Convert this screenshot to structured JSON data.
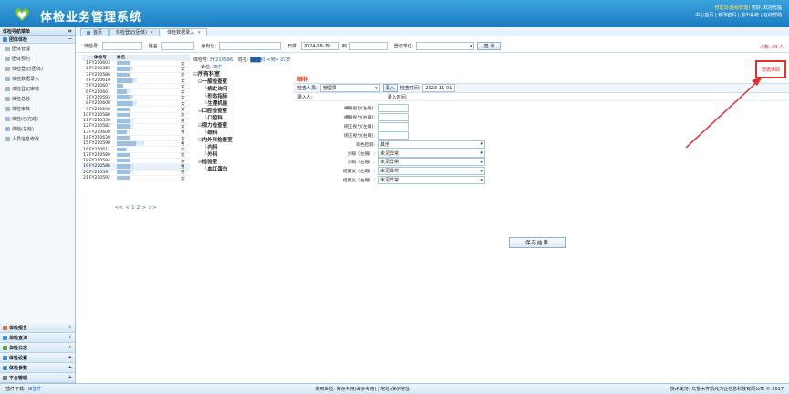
{
  "header": {
    "title": "体检业务管理系统",
    "user_line": "管理员(超级管理)",
    "user_links": "您好, 欢迎光临",
    "links": "中心首页 | 修改密码 | 退出系统 | 在线帮助"
  },
  "sidebar": {
    "heading": "体检导航菜单",
    "collapse": "«",
    "group": "团体体检",
    "group_toggle": "−",
    "items": [
      {
        "label": "团体管理"
      },
      {
        "label": "团体预约"
      },
      {
        "label": "体检登记(团体)"
      },
      {
        "label": "体检数据录入"
      },
      {
        "label": "体检登记审核"
      },
      {
        "label": "体检总检"
      },
      {
        "label": "体检审核"
      },
      {
        "label": "体检(已完成)"
      },
      {
        "label": "体检(总检)"
      },
      {
        "label": "人员信息修改"
      }
    ],
    "bottom_groups": [
      {
        "label": "体检报告",
        "toggle": "+",
        "color": "#e0703a"
      },
      {
        "label": "体检查询",
        "toggle": "+",
        "color": "#3b8fd0"
      },
      {
        "label": "体检日志",
        "toggle": "+",
        "color": "#6a9c3a"
      },
      {
        "label": "体检设置",
        "toggle": "+",
        "color": "#3b8fd0"
      },
      {
        "label": "体检参数",
        "toggle": "+",
        "color": "#3b8fd0"
      },
      {
        "label": "平台管理",
        "toggle": "+",
        "color": "#777777"
      }
    ]
  },
  "tabs": [
    {
      "label": "首页",
      "close": ""
    },
    {
      "label": "体检登记(团体)",
      "close": "×"
    },
    {
      "label": "体检数据录入",
      "close": "×"
    }
  ],
  "search": {
    "exam_no_label": "体检号:",
    "name_label": "姓名:",
    "id_label": "身份证:",
    "date_label": "日期:",
    "date_from": "2024-08-29",
    "date_to_label": "到",
    "unit_label": "登记单位:",
    "query_button": "查 询",
    "count": "人数: 29 人"
  },
  "table": {
    "headers": {
      "no": "",
      "exam_no": "体检号",
      "name": "姓名",
      "sex": ""
    },
    "rows": [
      {
        "no": "1",
        "exam_no": "FY210603",
        "name": "████",
        "sex": "女"
      },
      {
        "no": "2",
        "exam_no": "FY210585",
        "name": "████华",
        "sex": "女"
      },
      {
        "no": "3",
        "exam_no": "FY210586",
        "name": "████",
        "sex": "女"
      },
      {
        "no": "4",
        "exam_no": "FY210610",
        "name": "█████华",
        "sex": "女"
      },
      {
        "no": "5",
        "exam_no": "FY210607",
        "name": "██",
        "sex": "女"
      },
      {
        "no": "6",
        "exam_no": "FY210601",
        "name": "███华",
        "sex": "女"
      },
      {
        "no": "7",
        "exam_no": "FY210593",
        "name": "████英",
        "sex": "女"
      },
      {
        "no": "8",
        "exam_no": "FY210608",
        "name": "█████华",
        "sex": "女"
      },
      {
        "no": "9",
        "exam_no": "FY210590",
        "name": "████",
        "sex": "女"
      },
      {
        "no": "10",
        "exam_no": "FY210588",
        "name": "████",
        "sex": "女"
      },
      {
        "no": "11",
        "exam_no": "FY210550",
        "name": "████红",
        "sex": "男"
      },
      {
        "no": "12",
        "exam_no": "FY210582",
        "name": "████红",
        "sex": "女"
      },
      {
        "no": "13",
        "exam_no": "FY210600",
        "name": "███红",
        "sex": "男"
      },
      {
        "no": "14",
        "exam_no": "FY210630",
        "name": "████",
        "sex": "女"
      },
      {
        "no": "15",
        "exam_no": "FY210590",
        "name": "██████彩欣",
        "sex": "男"
      },
      {
        "no": "16",
        "exam_no": "FY210611",
        "name": "███",
        "sex": "女"
      },
      {
        "no": "17",
        "exam_no": "FY210589",
        "name": "████",
        "sex": "女"
      },
      {
        "no": "18",
        "exam_no": "FY210594",
        "name": "████",
        "sex": "女"
      },
      {
        "no": "19",
        "exam_no": "FY210586",
        "name": "████红",
        "sex": "男"
      },
      {
        "no": "20",
        "exam_no": "FY210591",
        "name": "████红",
        "sex": "男"
      },
      {
        "no": "21",
        "exam_no": "FY210592",
        "name": "████",
        "sex": "女"
      }
    ],
    "pager": "<< < 1 2 > >>"
  },
  "tree": {
    "exam_no_label": "体检号:",
    "exam_no": "FY210586",
    "name_label": "姓名:",
    "name_value": "███红 <男> 22岁",
    "unit_label": "单位:",
    "unit_value": "四中",
    "items": [
      {
        "label": "所有科室",
        "level": 0
      },
      {
        "label": "一般检查室",
        "level": 1
      },
      {
        "label": "病史询问",
        "level": 2
      },
      {
        "label": "形态指标",
        "level": 2
      },
      {
        "label": "生理机能",
        "level": 2
      },
      {
        "label": "口腔检查室",
        "level": 1
      },
      {
        "label": "口腔科",
        "level": 2
      },
      {
        "label": "视力检查室",
        "level": 1
      },
      {
        "label": "眼科",
        "level": 2
      },
      {
        "label": "内外科检查室",
        "level": 1
      },
      {
        "label": "内科",
        "level": 2
      },
      {
        "label": "外科",
        "level": 2
      },
      {
        "label": "检验室",
        "level": 1
      },
      {
        "label": "血红蛋白",
        "level": 2
      }
    ]
  },
  "form": {
    "title": "眼科",
    "examiner_label": "检查人员:",
    "examiner_value": "管理员",
    "entry_button": "录入",
    "time_label": "检查时间:",
    "time_value": "2023-11-01",
    "entry_person_label": "录入人:",
    "entry_time_label": "录入时间:",
    "fields": [
      {
        "label": "裸眼视力(左眼):",
        "type": "input",
        "value": ""
      },
      {
        "label": "裸眼视力(右眼):",
        "type": "input",
        "value": ""
      },
      {
        "label": "矫正视力(左眼):",
        "type": "input",
        "value": ""
      },
      {
        "label": "矫正视力(右眼):",
        "type": "input",
        "value": ""
      },
      {
        "label": "辨色检测:",
        "type": "select",
        "value": "其他"
      },
      {
        "label": "沙眼（左眼）:",
        "type": "select",
        "value": "未见异常"
      },
      {
        "label": "沙眼（右眼）:",
        "type": "select",
        "value": "未见异常"
      },
      {
        "label": "结膜炎（右眼）:",
        "type": "select",
        "value": "未见异常"
      },
      {
        "label": "结膜炎（左眼）:",
        "type": "select",
        "value": "未见异常"
      }
    ],
    "save_button": "保存结果",
    "history_button": "数据读取"
  },
  "footer": {
    "download_label": "插件下载:",
    "download_link": "IE插件",
    "center_text": "使用单位: 演示专用(演示专用) | 地址:演示地址",
    "right_text": "技术支持: 乌鲁木齐凯元力业信息科技有限公司 © 2017"
  },
  "colors": {
    "header_blue": "#1f86cc",
    "accent_red": "#e53030",
    "title_red": "#d93a1c"
  }
}
